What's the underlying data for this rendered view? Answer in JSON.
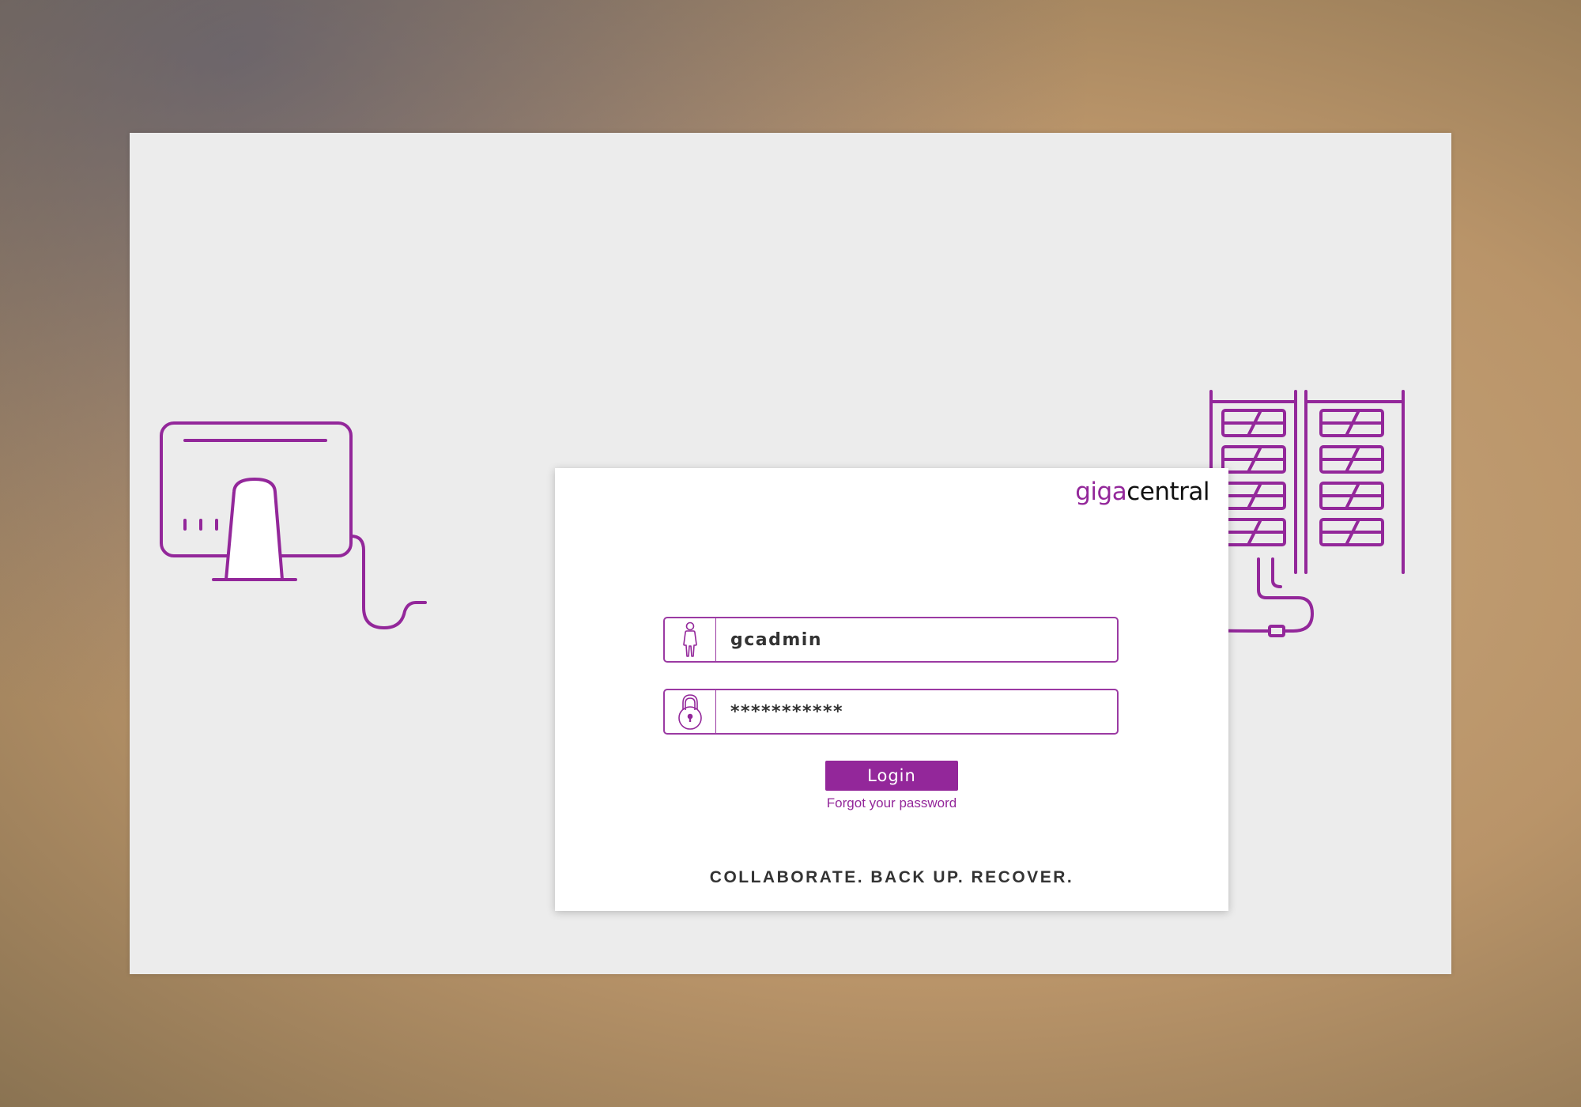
{
  "brand": {
    "part1": "giga",
    "part2": "central"
  },
  "login_form": {
    "username_value": "gcadmin",
    "password_value": "***********",
    "login_label": "Login",
    "forgot_label": "Forgot your password"
  },
  "tagline": "COLLABORATE. BACK UP. RECOVER.",
  "icons": {
    "username": "person-icon",
    "password": "padlock-icon",
    "illustration_left": "desktop-computer-icon",
    "illustration_right": [
      "cloud-icon",
      "server-rack-icon"
    ]
  },
  "colors": {
    "accent": "#93279a",
    "panel": "#ececec",
    "card": "#ffffff",
    "text": "#333333"
  }
}
